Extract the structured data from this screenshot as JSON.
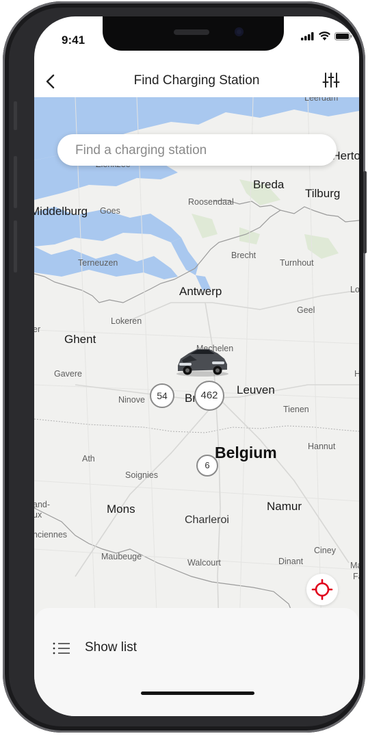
{
  "status_bar": {
    "time": "9:41"
  },
  "header": {
    "title": "Find Charging Station"
  },
  "search": {
    "placeholder": "Find a charging station"
  },
  "map": {
    "labels": {
      "zierikzee": "Zierikzee",
      "breda": "Breda",
      "tilburg": "Tilburg",
      "s_hertogenbosch": "'s-Herto",
      "middelburg": "Middelburg",
      "goes": "Goes",
      "roosendaal": "Roosendaal",
      "terneuzen": "Terneuzen",
      "brecht": "Brecht",
      "turnhout": "Turnhout",
      "antwerp": "Antwerp",
      "geel": "Geel",
      "lokeren": "Lokeren",
      "ghent": "Ghent",
      "mechelen": "Mechelen",
      "gavere": "Gavere",
      "ninove": "Ninove",
      "brussels": "Brus",
      "leuven": "Leuven",
      "tienen": "Tienen",
      "belgium": "Belgium",
      "hannut": "Hannut",
      "ath": "Ath",
      "soignies": "Soignies",
      "mons": "Mons",
      "charleroi": "Charleroi",
      "namur": "Namur",
      "maubeuge": "Maubeuge",
      "walcourt": "Walcourt",
      "dinant": "Dinant",
      "ciney": "Ciney",
      "leerdam": "Leerdam",
      "lo": "Lo",
      "er": "er",
      "and": "and-",
      "ux": "ux",
      "nciennes": "nciennes",
      "ma": "Ma",
      "fa": "Fa",
      "h": "H"
    },
    "clusters": [
      "54",
      "462",
      "6"
    ]
  },
  "bottom_sheet": {
    "show_list_label": "Show list"
  },
  "colors": {
    "accent": "#e0001b",
    "water": "#a9c8ef",
    "land": "#f1f1ef"
  }
}
